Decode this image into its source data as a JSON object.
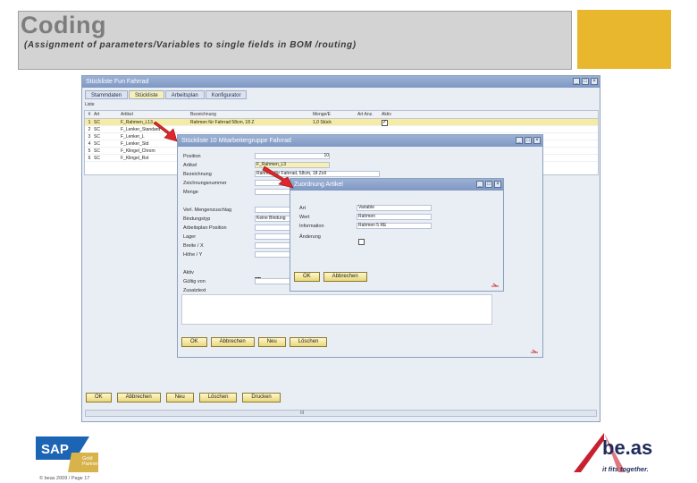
{
  "slide": {
    "title": "Coding",
    "subtitle": "(Assignment of parameters/Variables to single fields in BOM /routing)",
    "accent_color": "#e8b72d",
    "footer": "© beas 2009 / Page 17"
  },
  "main_window": {
    "title": "Stückliste Fun Fahrrad",
    "tabs": [
      "Stammdaten",
      "Stückliste",
      "Arbeitsplan",
      "Konfigurator"
    ],
    "list_label": "Liste",
    "columns": [
      "#",
      "Art",
      "Artikel",
      "Bezeichnung",
      "Menge/E",
      "Art Anz.",
      "Aktiv"
    ],
    "rows": [
      {
        "num": "1",
        "art": "SC",
        "artikel": "F_Rahmen_L13",
        "bez": "Rahmen für Fahrrad 58cm, 18 Z",
        "menge": "1,0 Stück",
        "aktiv": true
      },
      {
        "num": "2",
        "art": "SC",
        "artikel": "F_Lenker_Standard",
        "bez": "",
        "menge": "",
        "aktiv": false
      },
      {
        "num": "3",
        "art": "SC",
        "artikel": "F_Lenker_L",
        "bez": "",
        "menge": "",
        "aktiv": false
      },
      {
        "num": "4",
        "art": "SC",
        "artikel": "F_Lenker_Std",
        "bez": "",
        "menge": "",
        "aktiv": false
      },
      {
        "num": "5",
        "art": "SC",
        "artikel": "F_Klingel_Chrom",
        "bez": "",
        "menge": "",
        "aktiv": false
      },
      {
        "num": "6",
        "art": "SC",
        "artikel": "F_Klingel_Rot",
        "bez": "",
        "menge": "",
        "aktiv": false
      }
    ],
    "buttons": [
      "OK",
      "Abbrechen",
      "Neu",
      "Löschen",
      "Drucken"
    ],
    "scroll_marker": "III"
  },
  "stuck_window": {
    "title": "Stückliste 10 Mitarbeitergruppe Fahrrad",
    "labels": [
      "Position",
      "Artikel",
      "Bezeichnung",
      "Zeichnungsnummer",
      "Menge",
      "Verl. Mengenzuschlag",
      "Bindungstyp",
      "Arbeitsplan Position",
      "Lager",
      "Breite / X",
      "Höhe / Y",
      "Aktiv",
      "Gültig von",
      "Zusatztext"
    ],
    "position_value": "10",
    "artikel_value": "F_Rahmen_L3",
    "bezeichnung_value": "Rahmen für Fahrrad, 58cm, 18 Zoll",
    "bindung_value": "Keine Bindung",
    "buttons": [
      "OK",
      "Abbrechen",
      "Neu",
      "Löschen"
    ]
  },
  "zuord_window": {
    "title": "Zuordnung Artikel",
    "labels": [
      "Art",
      "Wert",
      "Information",
      "Änderung"
    ],
    "art_value": "Variable",
    "wert_value": "Rahmen",
    "info_value": "Rahmen 5 RE",
    "buttons": [
      "OK",
      "Abbrechen"
    ]
  },
  "logos": {
    "sap_text": "SAP",
    "sap_badge": "Gold Partner",
    "beas_text": "be.as",
    "beas_slogan": "it fits together."
  },
  "colors": {
    "title_gray": "#7d7d7d",
    "sap_blue": "#1c64b4",
    "sap_gold": "#d8b24a",
    "beas_red": "#c8202e"
  }
}
